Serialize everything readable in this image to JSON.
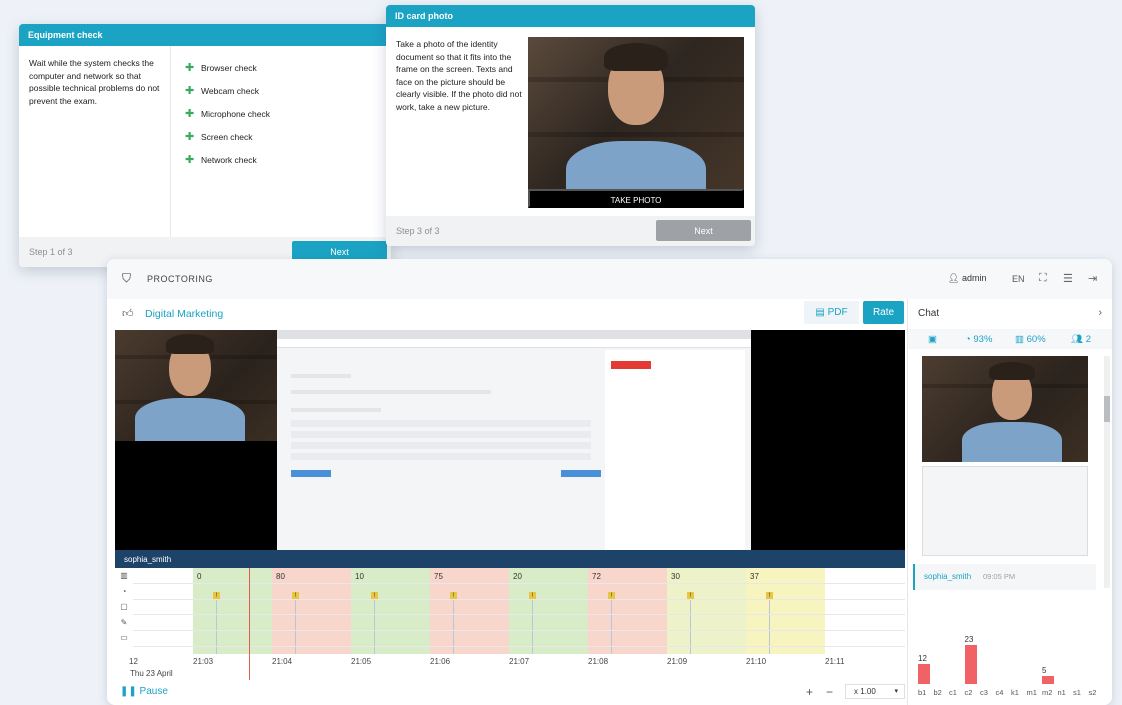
{
  "equipment_card": {
    "title": "Equipment check",
    "description": "Wait while the system checks the computer and network so that possible technical problems do not prevent the exam.",
    "checks": [
      "Browser check",
      "Webcam check",
      "Microphone check",
      "Screen check",
      "Network check"
    ],
    "step": "Step 1 of 3",
    "next_label": "Next"
  },
  "id_card": {
    "title": "ID card photo",
    "description": "Take a photo of the identity document so that it fits into the frame on the screen. Texts and face on the picture should be clearly visible. If the photo did not work, take a new picture.",
    "take_photo_label": "TAKE PHOTO",
    "step": "Step 3 of 3",
    "next_label": "Next"
  },
  "app": {
    "title": "PROCTORING",
    "user": "admin",
    "language": "EN",
    "exam_name": "Digital Marketing",
    "pdf_label": "PDF",
    "rate_label": "Rate",
    "student_name": "sophia_smith",
    "pause_label": "Pause",
    "speed": "x 1.00",
    "date": "Thu 23 April"
  },
  "timeline": {
    "segments": [
      {
        "value": "0",
        "color": "#d9ecc8"
      },
      {
        "value": "80",
        "color": "#f8d6cc"
      },
      {
        "value": "10",
        "color": "#d9ecc8"
      },
      {
        "value": "75",
        "color": "#f8d6cc"
      },
      {
        "value": "20",
        "color": "#d9ecc8"
      },
      {
        "value": "72",
        "color": "#f8d6cc"
      },
      {
        "value": "30",
        "color": "#eef2c8"
      },
      {
        "value": "37",
        "color": "#f8f4c0"
      }
    ],
    "times": [
      "12",
      "21:03",
      "21:04",
      "21:05",
      "21:06",
      "21:07",
      "21:08",
      "21:09",
      "21:10",
      "21:11"
    ]
  },
  "chat": {
    "title": "Chat",
    "stats": {
      "face": "93%",
      "chart": "60%",
      "people": "2"
    },
    "message_user": "sophia_smith",
    "message_time": "09:05 PM"
  },
  "chart_data": {
    "type": "bar",
    "categories": [
      "b1",
      "b2",
      "c1",
      "c2",
      "c3",
      "c4",
      "k1",
      "m1",
      "m2",
      "n1",
      "s1",
      "s2"
    ],
    "values": [
      12,
      0,
      0,
      23,
      0,
      0,
      0,
      0,
      5,
      0,
      0,
      0
    ],
    "ylim": [
      0,
      25
    ]
  },
  "colors": {
    "accent": "#1ba3c4",
    "danger": "#e35b4e",
    "bar": "#f06266"
  }
}
